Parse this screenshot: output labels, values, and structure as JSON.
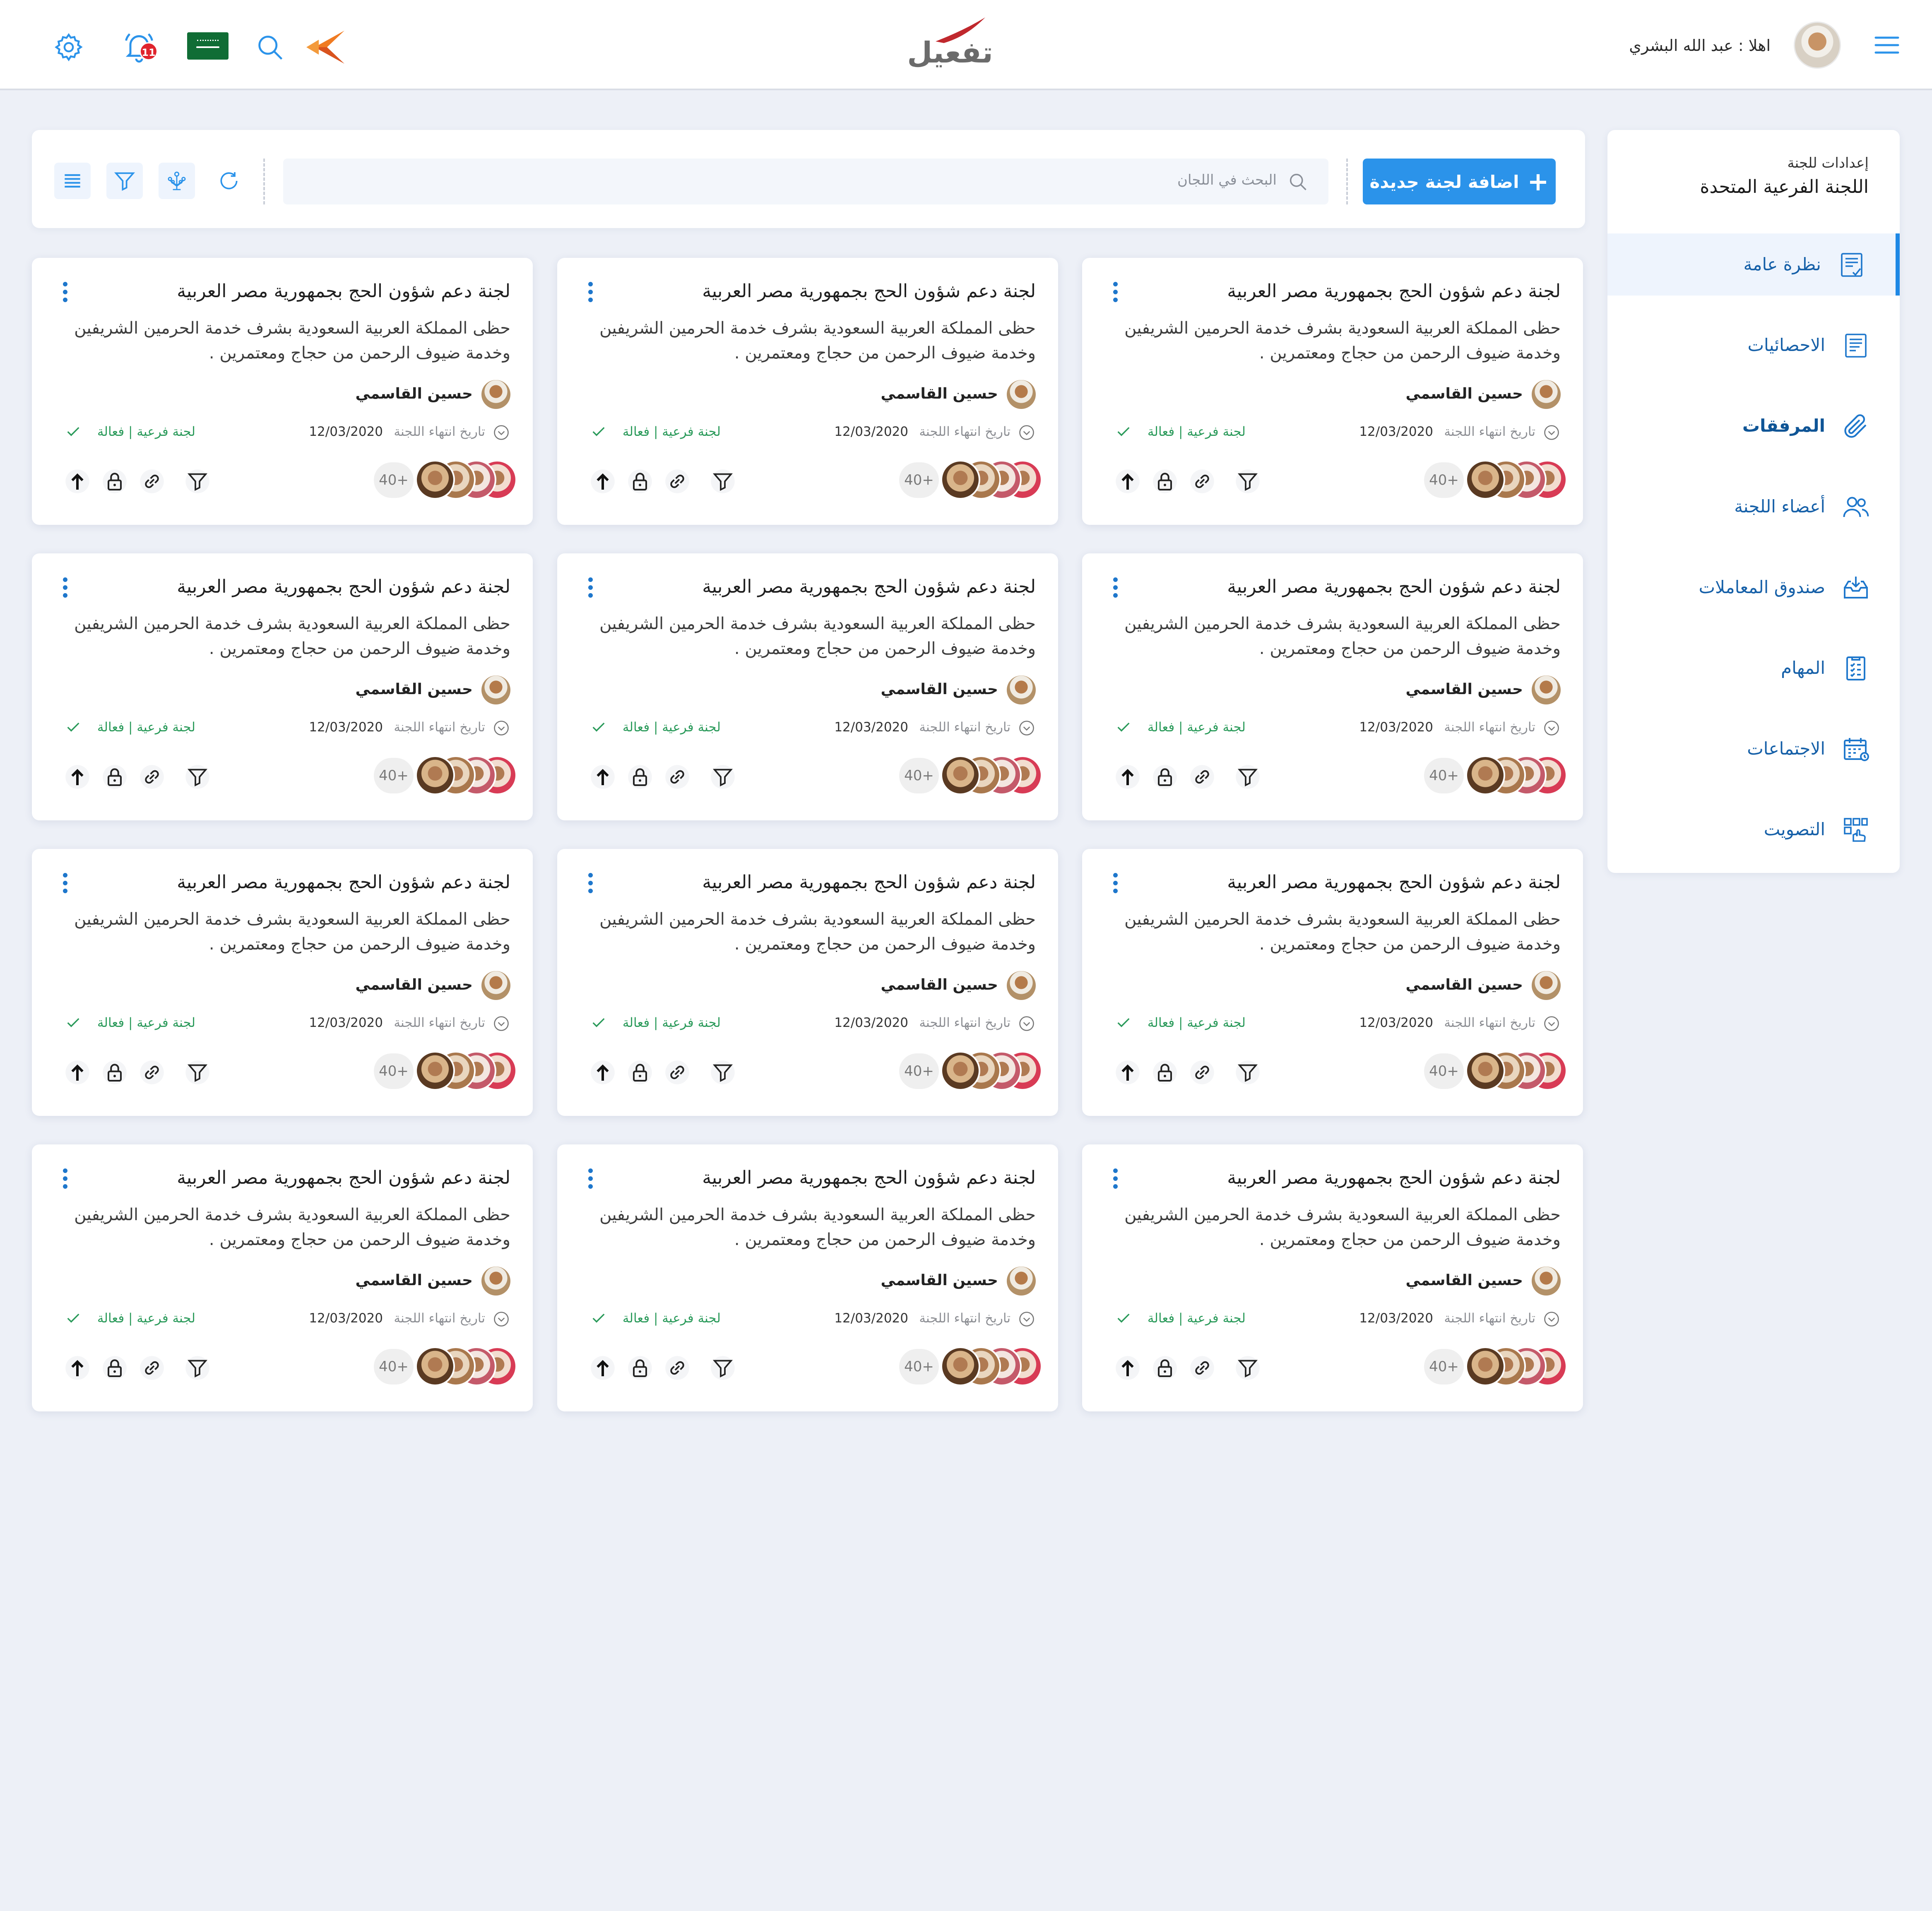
{
  "header": {
    "notification_count": "11",
    "logo_text": "تفعيل",
    "greeting": "اهلا : عبد الله البشري",
    "colors": {
      "accent": "#1e88e5",
      "logo_red": "#c0282d",
      "badge": "#e0242d"
    }
  },
  "sidebar": {
    "subtitle": "إعدادات للجنة",
    "title": "اللجنة الفرعية المتحدة",
    "items": [
      {
        "label": "نظرة عامة",
        "icon": "overview-icon",
        "active": true
      },
      {
        "label": "الاحصائيات",
        "icon": "statistics-icon"
      },
      {
        "label": "المرفقات",
        "icon": "attachment-icon"
      },
      {
        "label": "أعضاء اللجنة",
        "icon": "members-icon"
      },
      {
        "label": "صندوق المعاملات",
        "icon": "inbox-icon"
      },
      {
        "label": "المهام",
        "icon": "tasks-icon"
      },
      {
        "label": "الاجتماعات",
        "icon": "calendar-icon"
      },
      {
        "label": "التصويت",
        "icon": "voting-icon"
      }
    ]
  },
  "toolbar": {
    "add_label": "اضافة لجنة جديدة",
    "search_placeholder": "البحث في اللجان"
  },
  "cards": [
    {
      "title": "لجنة دعم شؤون الحج بجمهورية مصر العربية",
      "description": "حظى المملكة العربية السعودية بشرف خدمة الحرمين الشريفين وخدمة ضيوف الرحمن من حجاج ومعتمرين .",
      "owner": "حسين القاسمي",
      "date_label": "تاريخ انتهاء اللجنة",
      "date": "12/03/2020",
      "status": "لجنة فرعية | فعالة",
      "members_more": "40+"
    },
    {
      "title": "لجنة دعم شؤون الحج بجمهورية مصر العربية",
      "description": "حظى المملكة العربية السعودية بشرف خدمة الحرمين الشريفين وخدمة ضيوف الرحمن من حجاج ومعتمرين .",
      "owner": "حسين القاسمي",
      "date_label": "تاريخ انتهاء اللجنة",
      "date": "12/03/2020",
      "status": "لجنة فرعية | فعالة",
      "members_more": "40+"
    },
    {
      "title": "لجنة دعم شؤون الحج بجمهورية مصر العربية",
      "description": "حظى المملكة العربية السعودية بشرف خدمة الحرمين الشريفين وخدمة ضيوف الرحمن من حجاج ومعتمرين .",
      "owner": "حسين القاسمي",
      "date_label": "تاريخ انتهاء اللجنة",
      "date": "12/03/2020",
      "status": "لجنة فرعية | فعالة",
      "members_more": "40+"
    },
    {
      "title": "لجنة دعم شؤون الحج بجمهورية مصر العربية",
      "description": "حظى المملكة العربية السعودية بشرف خدمة الحرمين الشريفين وخدمة ضيوف الرحمن من حجاج ومعتمرين .",
      "owner": "حسين القاسمي",
      "date_label": "تاريخ انتهاء اللجنة",
      "date": "12/03/2020",
      "status": "لجنة فرعية | فعالة",
      "members_more": "40+"
    },
    {
      "title": "لجنة دعم شؤون الحج بجمهورية مصر العربية",
      "description": "حظى المملكة العربية السعودية بشرف خدمة الحرمين الشريفين وخدمة ضيوف الرحمن من حجاج ومعتمرين .",
      "owner": "حسين القاسمي",
      "date_label": "تاريخ انتهاء اللجنة",
      "date": "12/03/2020",
      "status": "لجنة فرعية | فعالة",
      "members_more": "40+"
    },
    {
      "title": "لجنة دعم شؤون الحج بجمهورية مصر العربية",
      "description": "حظى المملكة العربية السعودية بشرف خدمة الحرمين الشريفين وخدمة ضيوف الرحمن من حجاج ومعتمرين .",
      "owner": "حسين القاسمي",
      "date_label": "تاريخ انتهاء اللجنة",
      "date": "12/03/2020",
      "status": "لجنة فرعية | فعالة",
      "members_more": "40+"
    },
    {
      "title": "لجنة دعم شؤون الحج بجمهورية مصر العربية",
      "description": "حظى المملكة العربية السعودية بشرف خدمة الحرمين الشريفين وخدمة ضيوف الرحمن من حجاج ومعتمرين .",
      "owner": "حسين القاسمي",
      "date_label": "تاريخ انتهاء اللجنة",
      "date": "12/03/2020",
      "status": "لجنة فرعية | فعالة",
      "members_more": "40+"
    },
    {
      "title": "لجنة دعم شؤون الحج بجمهورية مصر العربية",
      "description": "حظى المملكة العربية السعودية بشرف خدمة الحرمين الشريفين وخدمة ضيوف الرحمن من حجاج ومعتمرين .",
      "owner": "حسين القاسمي",
      "date_label": "تاريخ انتهاء اللجنة",
      "date": "12/03/2020",
      "status": "لجنة فرعية | فعالة",
      "members_more": "40+"
    },
    {
      "title": "لجنة دعم شؤون الحج بجمهورية مصر العربية",
      "description": "حظى المملكة العربية السعودية بشرف خدمة الحرمين الشريفين وخدمة ضيوف الرحمن من حجاج ومعتمرين .",
      "owner": "حسين القاسمي",
      "date_label": "تاريخ انتهاء اللجنة",
      "date": "12/03/2020",
      "status": "لجنة فرعية | فعالة",
      "members_more": "40+"
    },
    {
      "title": "لجنة دعم شؤون الحج بجمهورية مصر العربية",
      "description": "حظى المملكة العربية السعودية بشرف خدمة الحرمين الشريفين وخدمة ضيوف الرحمن من حجاج ومعتمرين .",
      "owner": "حسين القاسمي",
      "date_label": "تاريخ انتهاء اللجنة",
      "date": "12/03/2020",
      "status": "لجنة فرعية | فعالة",
      "members_more": "40+"
    },
    {
      "title": "لجنة دعم شؤون الحج بجمهورية مصر العربية",
      "description": "حظى المملكة العربية السعودية بشرف خدمة الحرمين الشريفين وخدمة ضيوف الرحمن من حجاج ومعتمرين .",
      "owner": "حسين القاسمي",
      "date_label": "تاريخ انتهاء اللجنة",
      "date": "12/03/2020",
      "status": "لجنة فرعية | فعالة",
      "members_more": "40+"
    },
    {
      "title": "لجنة دعم شؤون الحج بجمهورية مصر العربية",
      "description": "حظى المملكة العربية السعودية بشرف خدمة الحرمين الشريفين وخدمة ضيوف الرحمن من حجاج ومعتمرين .",
      "owner": "حسين القاسمي",
      "date_label": "تاريخ انتهاء اللجنة",
      "date": "12/03/2020",
      "status": "لجنة فرعية | فعالة",
      "members_more": "40+"
    }
  ]
}
